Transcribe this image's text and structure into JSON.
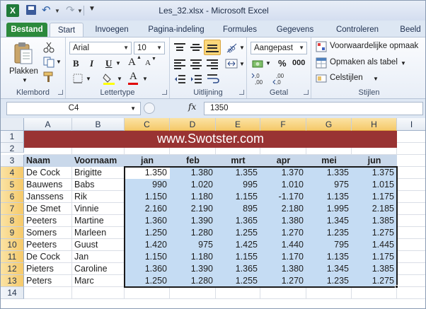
{
  "window": {
    "title": "Les_32.xlsx - Microsoft Excel"
  },
  "quick_access": {
    "app_icon": "X"
  },
  "tabs": [
    "Bestand",
    "Start",
    "Invoegen",
    "Pagina-indeling",
    "Formules",
    "Gegevens",
    "Controleren",
    "Beeld"
  ],
  "ribbon": {
    "clipboard": {
      "paste_label": "Plakken",
      "group_label": "Klembord"
    },
    "font": {
      "font_name": "Arial",
      "font_size": "10",
      "bold": "B",
      "italic": "I",
      "underline": "U",
      "font_color_glyph": "A",
      "grow_glyph": "A",
      "shrink_glyph": "A",
      "group_label": "Lettertype"
    },
    "alignment": {
      "group_label": "Uitlijning"
    },
    "number": {
      "format": "Aangepast",
      "currency": "$",
      "percent": "%",
      "comma": "000",
      "inc_decimal": ",0\n,00",
      "dec_decimal": ",00\n,0",
      "group_label": "Getal"
    },
    "styles": {
      "conditional": "Voorwaardelijke opmaak",
      "as_table": "Opmaken als tabel",
      "cell_styles": "Celstijlen",
      "group_label": "Stijlen"
    }
  },
  "formula_bar": {
    "name_box": "C4",
    "fx": "fx",
    "value": "1350"
  },
  "sheet": {
    "columns": [
      "A",
      "B",
      "C",
      "D",
      "E",
      "F",
      "G",
      "H",
      "I"
    ],
    "rows": [
      "1",
      "2",
      "3",
      "4",
      "5",
      "6",
      "7",
      "8",
      "9",
      "10",
      "11",
      "12",
      "13",
      "14"
    ],
    "banner": "www.Swotster.com",
    "header": [
      "Naam",
      "Voornaam",
      "jan",
      "feb",
      "mrt",
      "apr",
      "mei",
      "jun"
    ],
    "data": [
      [
        "De Cock",
        "Brigitte",
        "1.350",
        "1.380",
        "1.355",
        "1.370",
        "1.335",
        "1.375"
      ],
      [
        "Bauwens",
        "Babs",
        "990",
        "1.020",
        "995",
        "1.010",
        "975",
        "1.015"
      ],
      [
        "Janssens",
        "Rik",
        "1.150",
        "1.180",
        "1.155",
        "-1.170",
        "1.135",
        "1.175"
      ],
      [
        "De Smet",
        "Vinnie",
        "2.160",
        "2.190",
        "895",
        "2.180",
        "1.995",
        "2.185"
      ],
      [
        "Peeters",
        "Martine",
        "1.360",
        "1.390",
        "1.365",
        "1.380",
        "1.345",
        "1.385"
      ],
      [
        "Somers",
        "Marleen",
        "1.250",
        "1.280",
        "1.255",
        "1.270",
        "1.235",
        "1.275"
      ],
      [
        "Peeters",
        "Guust",
        "1.420",
        "975",
        "1.425",
        "1.440",
        "795",
        "1.445"
      ],
      [
        "De Cock",
        "Jan",
        "1.150",
        "1.180",
        "1.155",
        "1.170",
        "1.135",
        "1.175"
      ],
      [
        "Pieters",
        "Caroline",
        "1.360",
        "1.390",
        "1.365",
        "1.380",
        "1.345",
        "1.385"
      ],
      [
        "Peters",
        "Marc",
        "1.250",
        "1.280",
        "1.255",
        "1.270",
        "1.235",
        "1.275"
      ]
    ],
    "active_cell": "C4",
    "selection": "C4:H13"
  },
  "colors": {
    "file_tab": "#2c8a3c",
    "banner": "#993333",
    "selection_fill": "#c5dcf3",
    "header_fill": "#c9d8ea"
  }
}
